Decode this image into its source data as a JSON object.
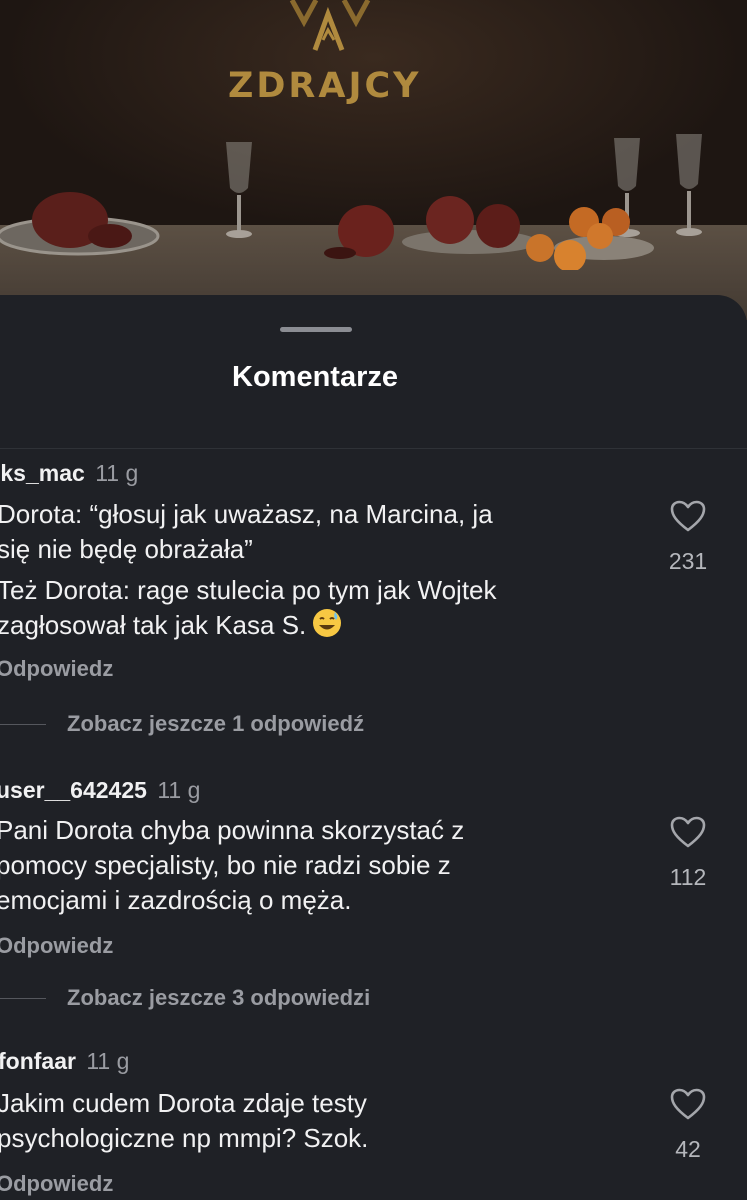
{
  "backdrop": {
    "logo_text": "ZDRAJCY"
  },
  "sheet": {
    "title": "Komentarze"
  },
  "comments": [
    {
      "username": "iks_mac",
      "time": "11 g",
      "body": "Dorota: “głosuj jak uważasz, na Marcina, ja\nsię nie będę obrażała”",
      "body2": "Też Dorota: rage stulecia po tym jak Wojtek\nzagłosował tak jak Kasa S.",
      "emoji": "sweat-smile-emoji",
      "likes": "231",
      "reply_label": "Odpowiedz",
      "more_replies": "Zobacz jeszcze 1 odpowiedź"
    },
    {
      "username": "user__642425",
      "time": "11 g",
      "body": "Pani Dorota chyba powinna skorzystać z\npomocy specjalisty, bo nie radzi sobie z\nemocjami i zazdrością o męża.",
      "likes": "112",
      "reply_label": "Odpowiedz",
      "more_replies": "Zobacz jeszcze 3 odpowiedzi"
    },
    {
      "username": "fonfaar",
      "time": "11 g",
      "body": "Jakim cudem Dorota zdaje testy\npsychologiczne np mmpi? Szok.",
      "likes": "42",
      "reply_label": "Odpowiedz"
    }
  ],
  "colors": {
    "sheet_bg": "#1f2126",
    "muted_text": "#9a9ca2",
    "logo_gold": "#b08a3e"
  }
}
